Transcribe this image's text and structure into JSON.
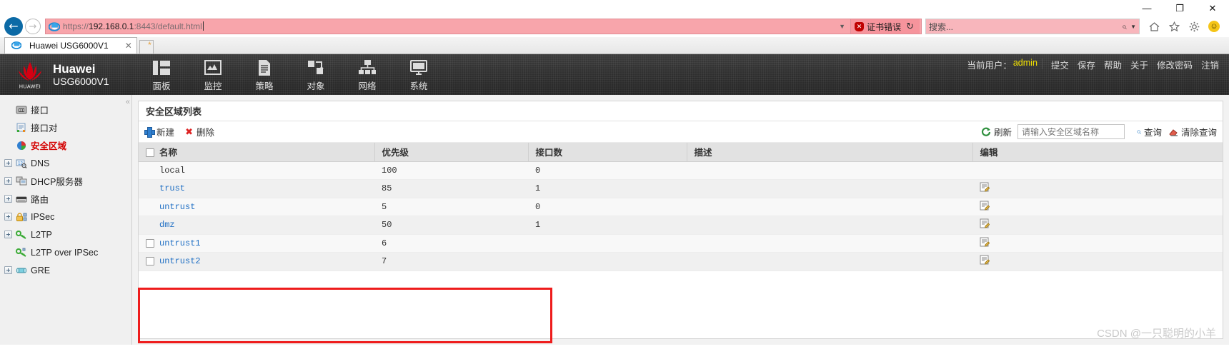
{
  "browser": {
    "window_controls": {
      "minimize": "—",
      "maximize": "❐",
      "close": "✕"
    },
    "back_label": "←",
    "forward_label": "→",
    "url_protocol": "https://",
    "url_host": "192.168.0.1",
    "url_path": ":8443/default.html",
    "url_full": "https://192.168.0.1:8443/default.html",
    "cert_error_text": "证书错误",
    "cert_error_badge": "✕",
    "refresh_glyph": "↻",
    "dropdown_glyph": "▼",
    "search_placeholder": "搜索...",
    "search_icon": "⌕",
    "search_caret": "▼",
    "icons": {
      "home": "home-icon",
      "favorites": "star-icon",
      "settings": "gear-icon",
      "smiley": "☺"
    },
    "tab": {
      "title": "Huawei USG6000V1",
      "close": "✕"
    },
    "newtab_label": ""
  },
  "app_header": {
    "brand_name": "Huawei",
    "brand_model": "USG6000V1",
    "brand_logo_text": "HUAWEI",
    "nav": [
      {
        "label": "面板",
        "icon": "dashboard-icon"
      },
      {
        "label": "监控",
        "icon": "monitor-icon"
      },
      {
        "label": "策略",
        "icon": "policy-icon"
      },
      {
        "label": "对象",
        "icon": "object-icon"
      },
      {
        "label": "网络",
        "icon": "network-icon"
      },
      {
        "label": "系统",
        "icon": "system-icon"
      }
    ],
    "current_user_label": "当前用户：",
    "current_user": "admin",
    "actions": [
      "提交",
      "保存",
      "帮助",
      "关于",
      "修改密码",
      "注销"
    ]
  },
  "sidebar": {
    "collapse_glyph": "«",
    "items": [
      {
        "label": "接口",
        "icon": "interface-icon",
        "expandable": false,
        "active": false
      },
      {
        "label": "接口对",
        "icon": "interface-pair-icon",
        "expandable": false,
        "active": false
      },
      {
        "label": "安全区域",
        "icon": "security-zone-icon",
        "expandable": false,
        "active": true
      },
      {
        "label": "DNS",
        "icon": "dns-icon",
        "expandable": true,
        "active": false
      },
      {
        "label": "DHCP服务器",
        "icon": "dhcp-icon",
        "expandable": true,
        "active": false
      },
      {
        "label": "路由",
        "icon": "route-icon",
        "expandable": true,
        "active": false
      },
      {
        "label": "IPSec",
        "icon": "ipsec-lock-icon",
        "expandable": true,
        "active": false
      },
      {
        "label": "L2TP",
        "icon": "l2tp-key-icon",
        "expandable": true,
        "active": false
      },
      {
        "label": "L2TP over IPSec",
        "icon": "l2tp-over-ipsec-icon",
        "expandable": false,
        "active": false
      },
      {
        "label": "GRE",
        "icon": "gre-tunnel-icon",
        "expandable": true,
        "active": false
      }
    ]
  },
  "panel": {
    "title": "安全区域列表",
    "toolbar": {
      "new_label": "新建",
      "delete_label": "删除",
      "refresh_label": "刷新",
      "search_placeholder": "请输入安全区域名称",
      "search_value": "",
      "query_label": "查询",
      "clear_query_label": "清除查询"
    },
    "table": {
      "columns": [
        "名称",
        "优先级",
        "接口数",
        "描述",
        "编辑"
      ],
      "rows": [
        {
          "checkbox": false,
          "name": "local",
          "link": false,
          "priority": "100",
          "interfaces": "0",
          "description": "",
          "edit": true,
          "highlight": false
        },
        {
          "checkbox": false,
          "name": "trust",
          "link": true,
          "priority": "85",
          "interfaces": "1",
          "description": "",
          "edit": true,
          "highlight": false
        },
        {
          "checkbox": false,
          "name": "untrust",
          "link": true,
          "priority": "5",
          "interfaces": "0",
          "description": "",
          "edit": true,
          "highlight": false
        },
        {
          "checkbox": false,
          "name": "dmz",
          "link": true,
          "priority": "50",
          "interfaces": "1",
          "description": "",
          "edit": true,
          "highlight": false
        },
        {
          "checkbox": true,
          "name": "untrust1",
          "link": true,
          "priority": "6",
          "interfaces": "",
          "description": "",
          "edit": true,
          "highlight": true
        },
        {
          "checkbox": true,
          "name": "untrust2",
          "link": true,
          "priority": "7",
          "interfaces": "",
          "description": "",
          "edit": true,
          "highlight": true
        }
      ]
    }
  },
  "watermark": "CSDN @一只聪明的小羊",
  "colors": {
    "accent_red": "#d40000",
    "highlight_box": "#ee1c1c",
    "link_blue": "#1f6fc4",
    "user_yellow": "#f3e200",
    "address_bar_error": "#f8a5ab"
  }
}
